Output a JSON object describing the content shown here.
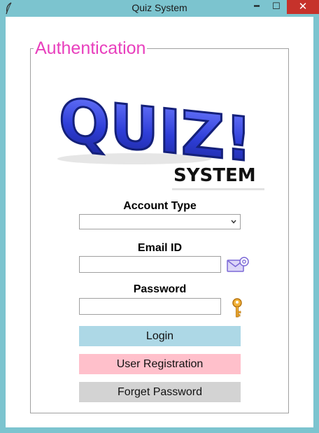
{
  "window": {
    "title": "Quiz System",
    "minimize_glyph": "━",
    "maximize_glyph": "☐",
    "close_glyph": "✕"
  },
  "auth": {
    "legend": "Authentication",
    "logo": {
      "word1": "QUIZ!",
      "word2": "SYSTEM"
    },
    "account_type": {
      "label": "Account Type",
      "value": ""
    },
    "email": {
      "label": "Email ID",
      "value": ""
    },
    "password": {
      "label": "Password",
      "value": ""
    },
    "buttons": {
      "login": "Login",
      "register": "User Registration",
      "forget": "Forget Password"
    }
  },
  "icons": {
    "app": "feather-icon",
    "email": "email-envelope-icon",
    "password": "key-icon",
    "dropdown": "chevron-down-icon"
  },
  "colors": {
    "titlebar": "#7cc4cf",
    "legend": "#e83fbd",
    "login": "#add8e6",
    "register": "#ffc0cb",
    "forget": "#d3d3d3",
    "logo_blue": "#2f3fd6"
  }
}
